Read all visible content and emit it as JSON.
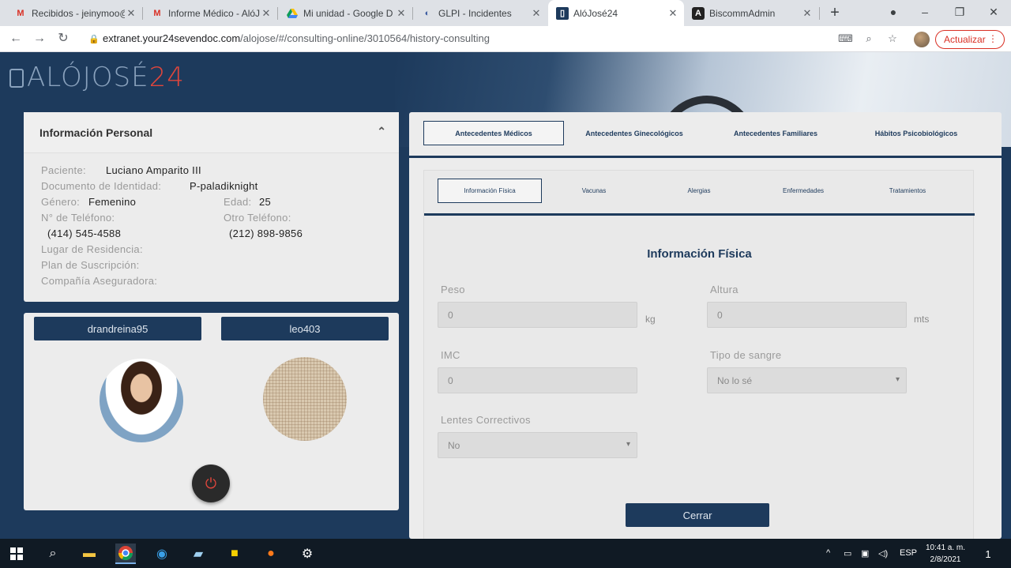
{
  "browser": {
    "tabs": [
      {
        "title": "Recibidos - jeinymoo@",
        "icon": "gmail-icon"
      },
      {
        "title": "Informe Médico - AlóJ",
        "icon": "gmail-icon"
      },
      {
        "title": "Mi unidad - Google D",
        "icon": "drive-icon"
      },
      {
        "title": "GLPI - Incidentes",
        "icon": "glpi-icon"
      },
      {
        "title": "AlóJosé24",
        "icon": "alojose-icon"
      },
      {
        "title": "BiscommAdmin",
        "icon": "angular-icon"
      }
    ],
    "url_domain": "extranet.your24sevendoc.com",
    "url_path": "/alojose/#/consulting-online/3010564/history-consulting",
    "update_label": "Actualizar"
  },
  "logo": {
    "text": "ALÓJOSÉ",
    "number": "24"
  },
  "personal_info": {
    "title": "Información Personal",
    "paciente_label": "Paciente:",
    "paciente": "Luciano Amparito III",
    "documento_label": "Documento de Identidad:",
    "documento": "P-paladiknight",
    "genero_label": "Género:",
    "genero": "Femenino",
    "edad_label": "Edad:",
    "edad": "25",
    "telefono_label": "N° de Teléfono:",
    "telefono": "(414) 545-4588",
    "otro_telefono_label": "Otro Teléfono:",
    "otro_telefono": "(212) 898-9856",
    "residencia_label": "Lugar de Residencia:",
    "plan_label": "Plan de Suscripción:",
    "aseguradora_label": "Compañía Aseguradora:"
  },
  "users": {
    "doctor": "drandreina95",
    "patient": "leo403"
  },
  "tabs_main": [
    "Antecedentes Médicos",
    "Antecedentes Ginecológicos",
    "Antecedentes Familiares",
    "Hábitos Psicobiológicos"
  ],
  "tabs_sub": [
    "Información Física",
    "Vacunas",
    "Alergias",
    "Enfermedades",
    "Tratamientos"
  ],
  "form": {
    "title": "Información Física",
    "peso_label": "Peso",
    "peso_value": "0",
    "peso_unit": "kg",
    "altura_label": "Altura",
    "altura_value": "0",
    "altura_unit": "mts",
    "imc_label": "IMC",
    "imc_value": "0",
    "sangre_label": "Tipo de sangre",
    "sangre_value": "No lo sé",
    "lentes_label": "Lentes Correctivos",
    "lentes_value": "No",
    "close_label": "Cerrar"
  },
  "taskbar": {
    "lang": "ESP",
    "time": "10:41 a. m.",
    "date": "2/8/2021",
    "notifications": "1"
  }
}
